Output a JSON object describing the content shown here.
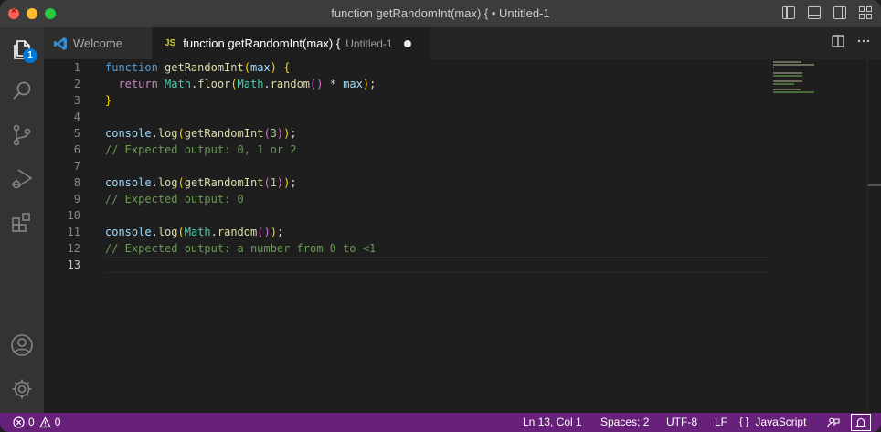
{
  "window": {
    "title": "function getRandomInt(max) { • Untitled-1"
  },
  "activity_bar": {
    "explorer_badge": "1"
  },
  "tabs": [
    {
      "label": "Welcome",
      "icon": "vscode-logo-icon"
    },
    {
      "lang": "JS",
      "label": "function getRandomInt(max) {",
      "description": "Untitled-1",
      "dirty": true
    }
  ],
  "editor": {
    "line_numbers": [
      "1",
      "2",
      "3",
      "4",
      "5",
      "6",
      "7",
      "8",
      "9",
      "10",
      "11",
      "12",
      "13"
    ],
    "current_line": 13,
    "lines": [
      "function getRandomInt(max) {",
      "  return Math.floor(Math.random() * max);",
      "}",
      "",
      "console.log(getRandomInt(3));",
      "// Expected output: 0, 1 or 2",
      "",
      "console.log(getRandomInt(1));",
      "// Expected output: 0",
      "",
      "console.log(Math.random());",
      "// Expected output: a number from 0 to <1",
      ""
    ]
  },
  "status_bar": {
    "errors": "0",
    "warnings": "0",
    "position": "Ln 13, Col 1",
    "indent": "Spaces: 2",
    "encoding": "UTF-8",
    "eol": "LF",
    "language_icon": "{ }",
    "language": "JavaScript",
    "color": "#68217a"
  }
}
